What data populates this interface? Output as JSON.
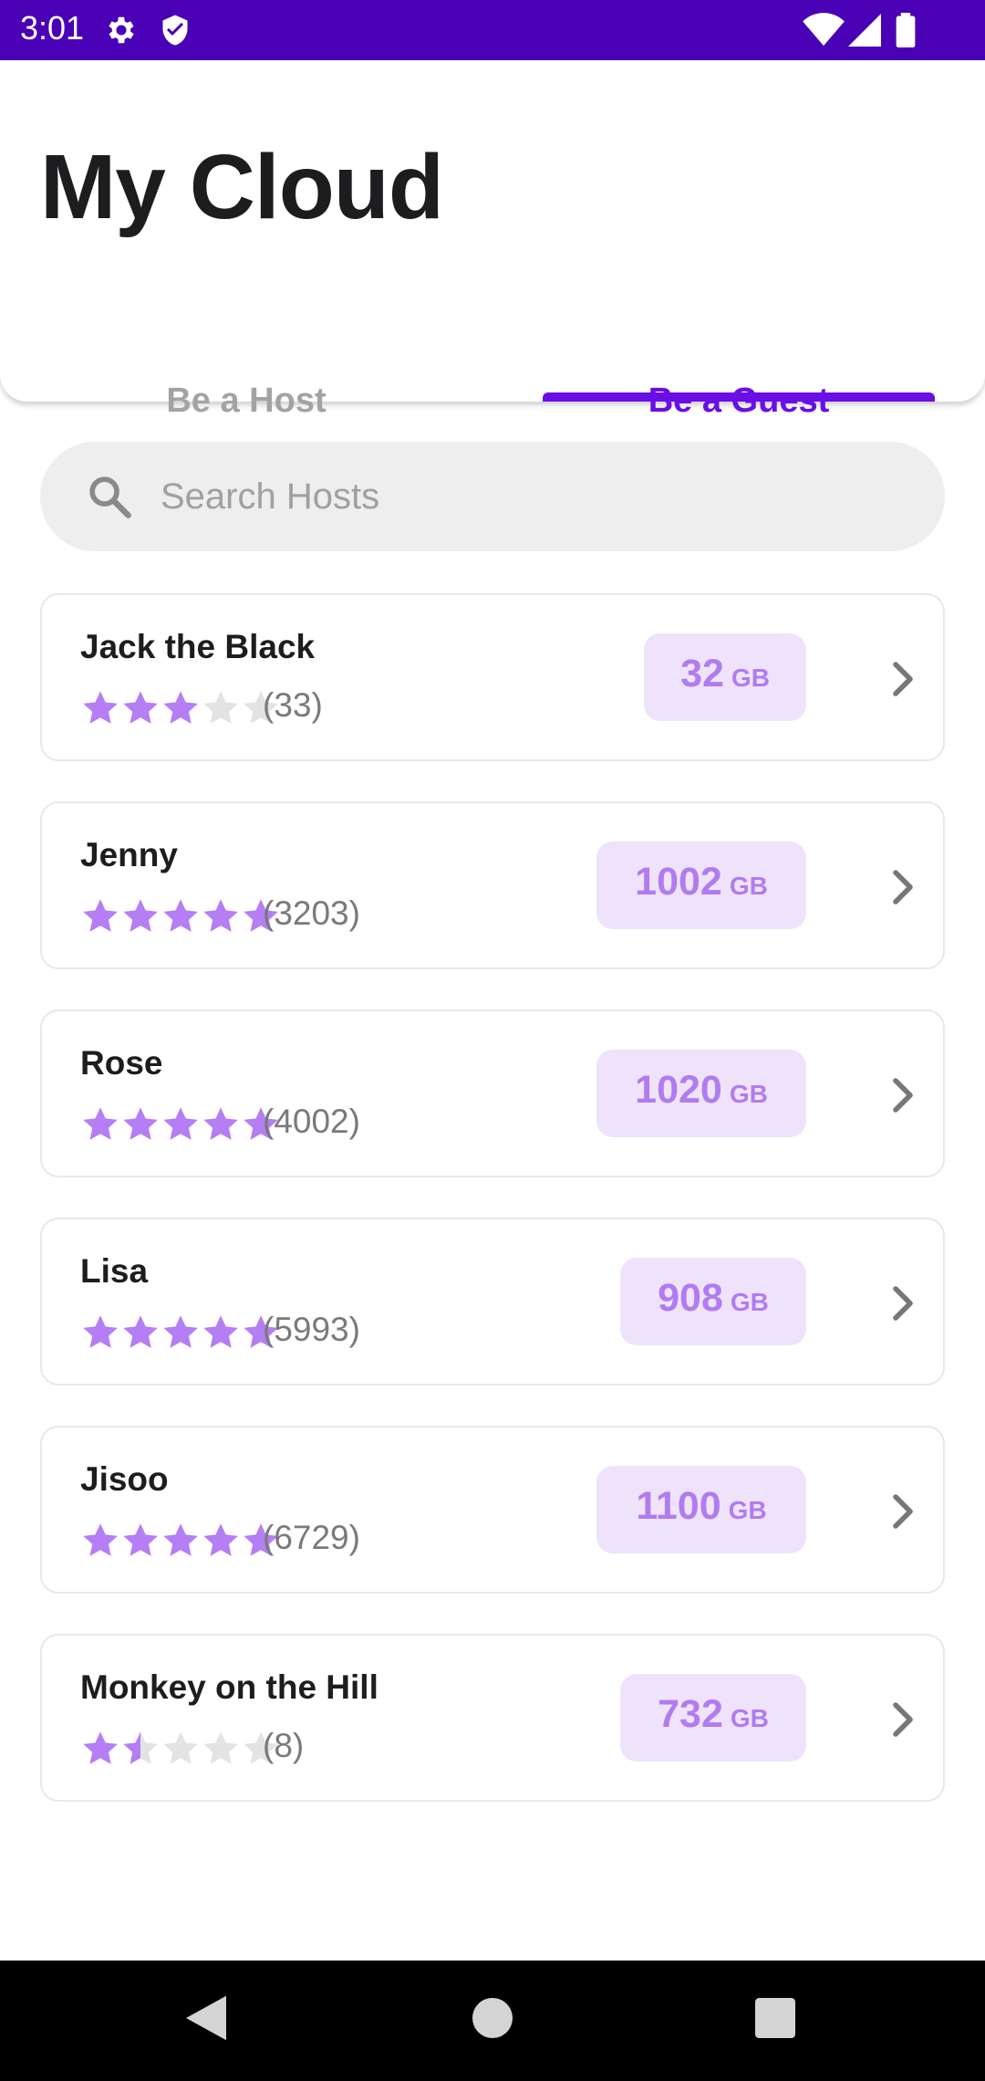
{
  "status_bar": {
    "time": "3:01",
    "icons": [
      "gear-icon",
      "shield-icon",
      "wifi-icon",
      "signal-icon",
      "battery-icon"
    ],
    "background": "#4a00b4"
  },
  "header": {
    "title": "My Cloud",
    "tabs": [
      {
        "label": "Be a Host",
        "active": false
      },
      {
        "label": "Be a Guest",
        "active": true
      }
    ],
    "accent_color": "#6a0ee6"
  },
  "search": {
    "placeholder": "Search Hosts",
    "value": ""
  },
  "hosts": [
    {
      "name": "Jack the Black",
      "rating": 3,
      "reviews": "(33)",
      "storage": "32",
      "unit": "GB"
    },
    {
      "name": "Jenny",
      "rating": 5,
      "reviews": "(3203)",
      "storage": "1002",
      "unit": "GB"
    },
    {
      "name": "Rose",
      "rating": 5,
      "reviews": "(4002)",
      "storage": "1020",
      "unit": "GB"
    },
    {
      "name": "Lisa",
      "rating": 5,
      "reviews": "(5993)",
      "storage": "908",
      "unit": "GB"
    },
    {
      "name": "Jisoo",
      "rating": 5,
      "reviews": "(6729)",
      "storage": "1100",
      "unit": "GB"
    },
    {
      "name": "Monkey on the Hill",
      "rating": 1.5,
      "reviews": "(8)",
      "storage": "732",
      "unit": "GB"
    }
  ],
  "colors": {
    "star_filled": "#b57ef5",
    "star_empty": "#e3e3e3",
    "badge_bg": "#efe3fb",
    "badge_text": "#b07cf0"
  },
  "nav_bar": {
    "buttons": [
      "back-icon",
      "home-icon",
      "recents-icon"
    ]
  }
}
